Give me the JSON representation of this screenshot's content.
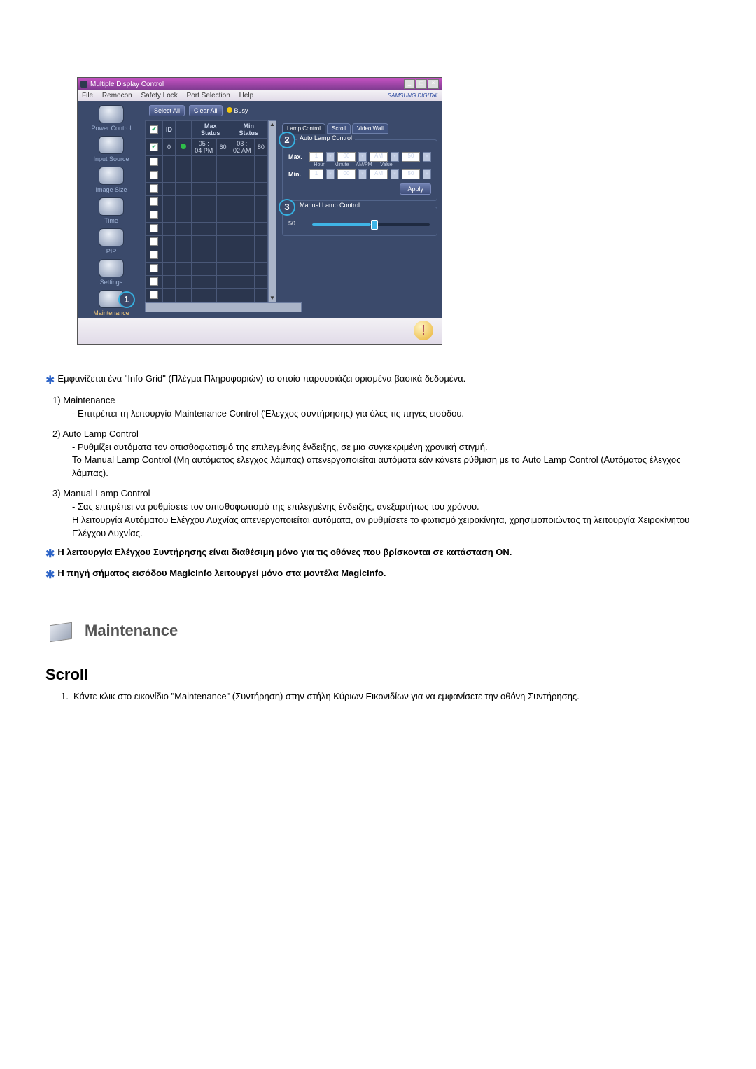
{
  "window": {
    "title": "Multiple Display Control",
    "menus": [
      "File",
      "Remocon",
      "Safety Lock",
      "Port Selection",
      "Help"
    ],
    "brand": "SAMSUNG DIGITall"
  },
  "sidebar": {
    "items": [
      {
        "label": "Power Control"
      },
      {
        "label": "Input Source"
      },
      {
        "label": "Image Size"
      },
      {
        "label": "Time"
      },
      {
        "label": "PIP"
      },
      {
        "label": "Settings"
      },
      {
        "label": "Maintenance"
      }
    ]
  },
  "toolbar": {
    "select_all": "Select All",
    "clear_all": "Clear All",
    "busy": "Busy"
  },
  "grid": {
    "headers": {
      "chk": "",
      "id": "ID",
      "status": "",
      "max": "Max Status",
      "min": "Min Status"
    },
    "rows": [
      {
        "id": "0",
        "max_time": "05 : 04 PM",
        "max_val": "60",
        "min_time": "03 : 02 AM",
        "min_val": "80"
      }
    ]
  },
  "right": {
    "tabs": [
      "Lamp Control",
      "Scroll",
      "Video Wall"
    ],
    "auto_group": "Auto Lamp Control",
    "manual_group": "Manual Lamp Control",
    "labels": {
      "max": "Max.",
      "min": "Min.",
      "hour": "Hour",
      "minute": "Minute",
      "ampm": "AM/PM",
      "value": "Value"
    },
    "max": {
      "hour": "1",
      "minute": "00",
      "ampm": "AM",
      "value": "50"
    },
    "min": {
      "hour": "1",
      "minute": "00",
      "ampm": "AM",
      "value": "50"
    },
    "apply": "Apply",
    "manual_value": "50"
  },
  "badges": {
    "one": "1",
    "two": "2",
    "three": "3"
  },
  "doc": {
    "intro": "Εμφανίζεται ένα \"Info Grid\" (Πλέγμα Πληροφοριών) το οποίο παρουσιάζει ορισμένα βασικά δεδομένα.",
    "items": [
      {
        "num": "1)",
        "title": "Maintenance",
        "desc": "- Επιτρέπει τη λειτουργία Maintenance Control (Έλεγχος συντήρησης) για όλες τις πηγές εισόδου."
      },
      {
        "num": "2)",
        "title": "Auto Lamp Control",
        "desc": "- Ρυθμίζει αυτόματα τον οπισθοφωτισμό της επιλεγμένης ένδειξης, σε μια συγκεκριμένη χρονική στιγμή.\nΤο Manual Lamp Control (Μη αυτόματος έλεγχος λάμπας) απενεργοποιείται αυτόματα εάν κάνετε ρύθμιση με το Auto Lamp Control (Αυτόματος έλεγχος λάμπας)."
      },
      {
        "num": "3)",
        "title": "Manual Lamp Control",
        "desc": "- Σας επιτρέπει να ρυθμίσετε τον οπισθοφωτισμό της επιλεγμένης ένδειξης, ανεξαρτήτως του χρόνου.\nΗ λειτουργία Αυτόματου Ελέγχου Λυχνίας απενεργοποιείται αυτόματα, αν ρυθμίσετε το φωτισμό χειροκίνητα, χρησιμοποιώντας τη λειτουργία Χειροκίνητου Ελέγχου Λυχνίας."
      }
    ],
    "note1": "Η λειτουργία Ελέγχου Συντήρησης είναι διαθέσιμη μόνο για τις οθόνες που βρίσκονται σε κατάσταση ON.",
    "note2": "Η πηγή σήματος εισόδου MagicInfo λειτουργεί μόνο στα μοντέλα MagicInfo.",
    "section_title": "Maintenance",
    "h2": "Scroll",
    "scroll_num": "1.",
    "scroll_text": "Κάντε κλικ στο εικονίδιο \"Maintenance\" (Συντήρηση) στην στήλη Κύριων Εικονιδίων για να εμφανίσετε την οθόνη Συντήρησης."
  }
}
